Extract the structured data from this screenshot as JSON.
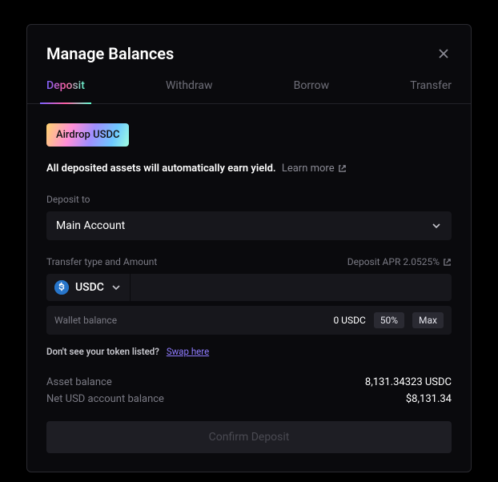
{
  "modal": {
    "title": "Manage Balances"
  },
  "tabs": {
    "deposit": "Deposit",
    "withdraw": "Withdraw",
    "borrow": "Borrow",
    "transfer": "Transfer"
  },
  "airdrop": {
    "label": "Airdrop USDC"
  },
  "yield": {
    "text": "All deposited assets will automatically earn yield.",
    "learn_more": "Learn more"
  },
  "deposit_to": {
    "label": "Deposit to",
    "value": "Main Account"
  },
  "transfer": {
    "label": "Transfer type and Amount",
    "apr_label": "Deposit APR 2.0525%",
    "token": "USDC",
    "amount": ""
  },
  "wallet": {
    "label": "Wallet balance",
    "balance": "0 USDC",
    "fifty": "50%",
    "max": "Max"
  },
  "swap": {
    "question": "Don't see your token listed?",
    "link": "Swap here"
  },
  "balances": {
    "asset_label": "Asset balance",
    "asset_value": "8,131.34323 USDC",
    "net_label": "Net USD account balance",
    "net_value": "$8,131.34"
  },
  "confirm": {
    "label": "Confirm Deposit"
  }
}
